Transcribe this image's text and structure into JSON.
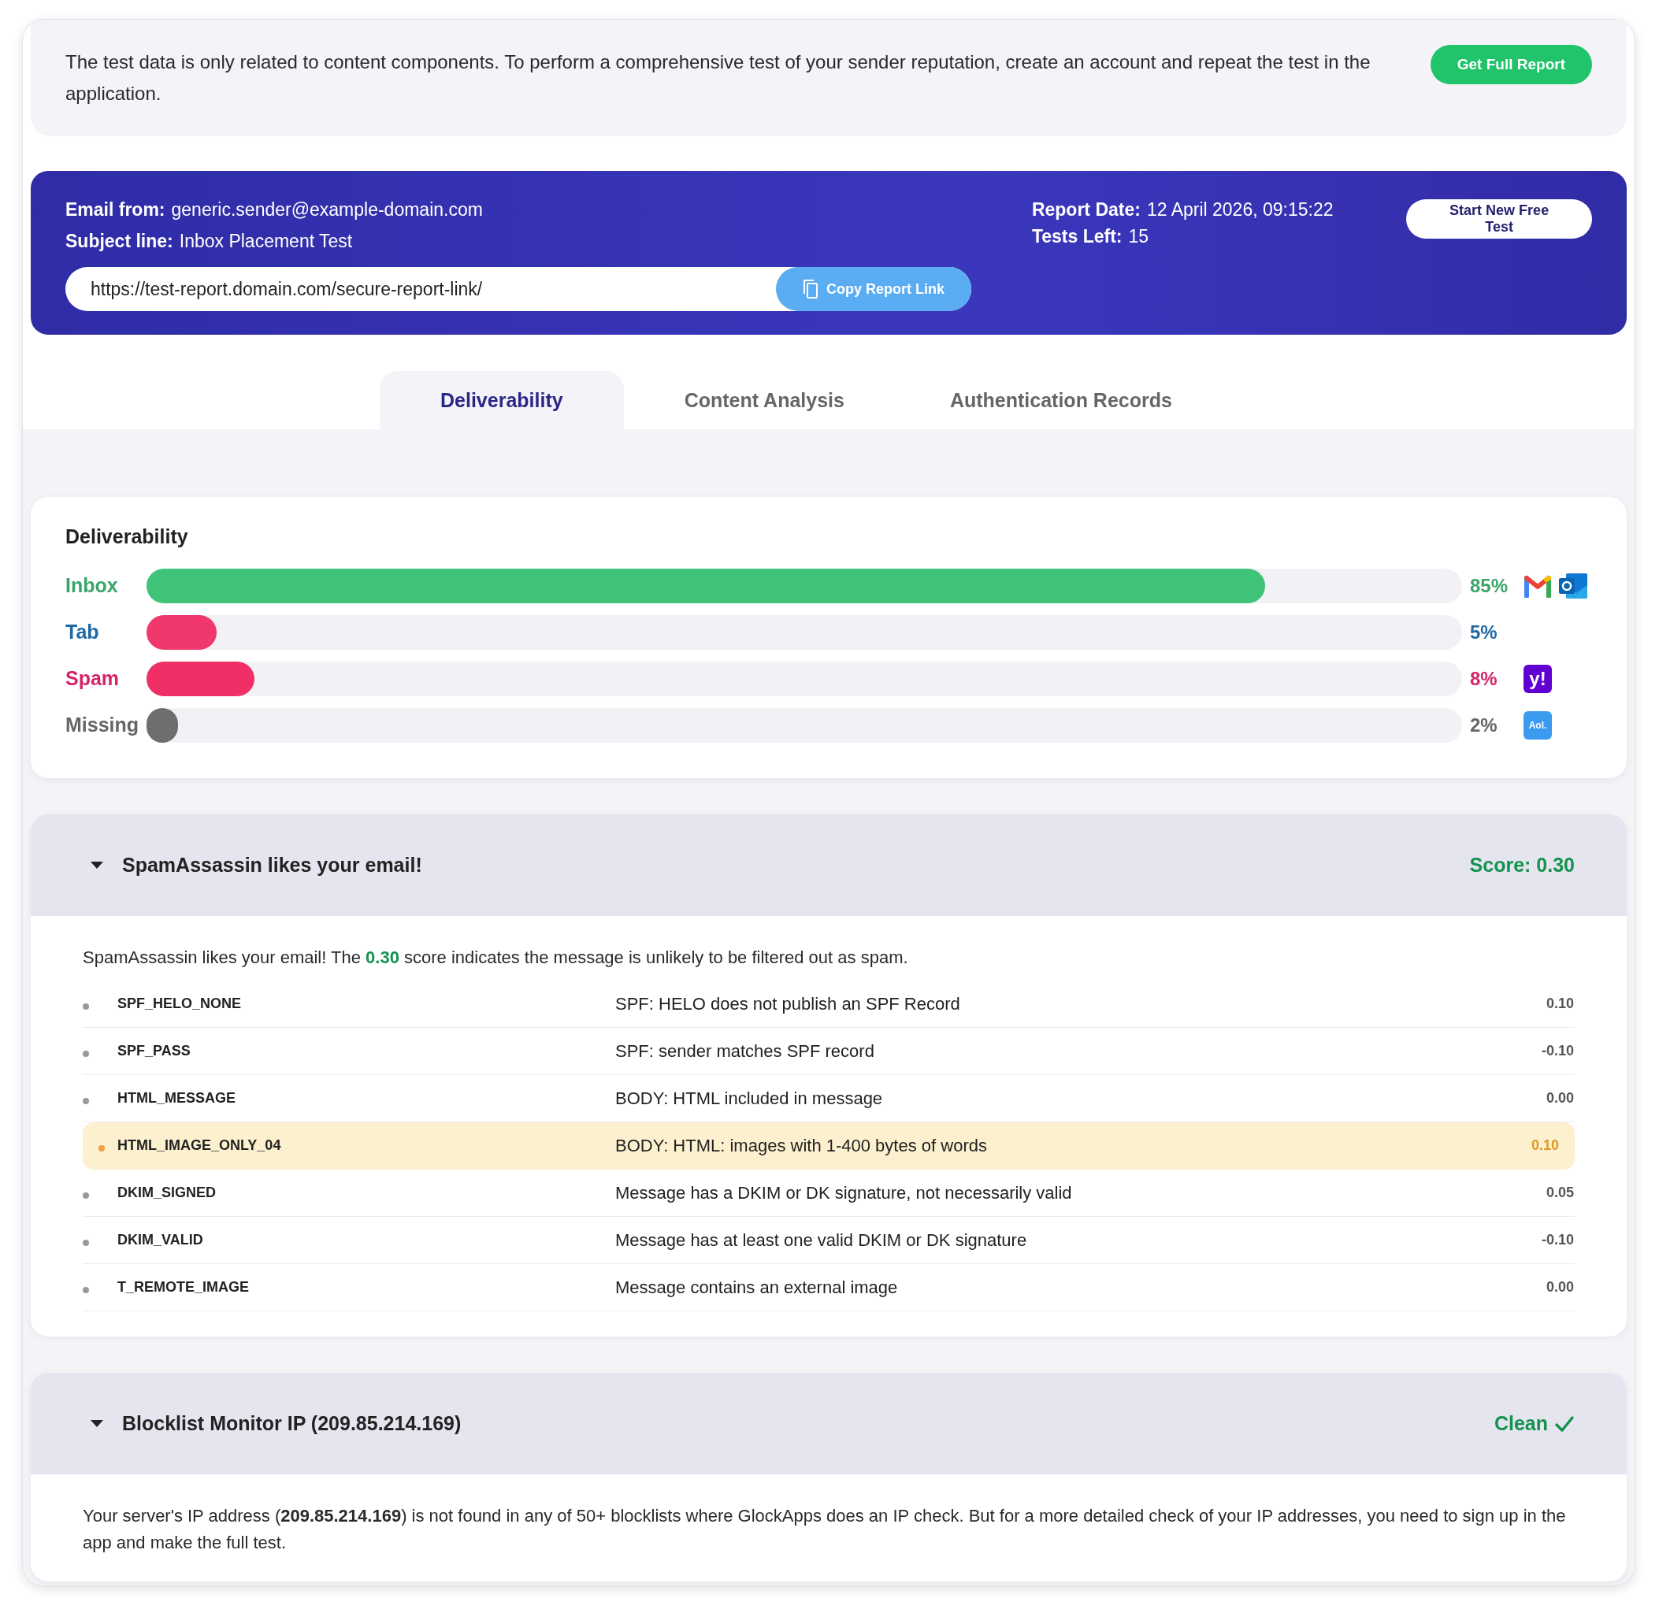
{
  "notice": {
    "text": "The test data is only related to content components. To perform a comprehensive test of your sender reputation, create an account and repeat the test in the application.",
    "button": "Get Full Report"
  },
  "report": {
    "fields": [
      {
        "label": "Email from:",
        "value": "generic.sender@example-domain.com"
      },
      {
        "label": "Subject line:",
        "value": "Inbox Placement Test"
      }
    ],
    "meta": [
      {
        "label": "Report Date:",
        "value": "12 April 2026, 09:15:22"
      },
      {
        "label": "Tests Left:",
        "value": "15"
      }
    ],
    "link": "https://test-report.domain.com/secure-report-link/",
    "copy_button": "Copy Report Link",
    "new_test_button": "Start New Free Test"
  },
  "tabs": [
    {
      "label": "Deliverability",
      "selected": true
    },
    {
      "label": "Content Analysis",
      "selected": false
    },
    {
      "label": "Authentication Records",
      "selected": false
    }
  ],
  "deliverability": {
    "title": "Deliverability",
    "rows": [
      {
        "label": "Inbox",
        "level": 0.85,
        "reading": "85%",
        "color": "#3fc378",
        "icons": [
          {
            "kind": "gmail"
          },
          {
            "kind": "outlook"
          }
        ]
      },
      {
        "label": "Tab",
        "level": 0.053,
        "reading": "5%",
        "color": "#f0386c",
        "icons": []
      },
      {
        "label": "Spam",
        "level": 0.082,
        "reading": "8%",
        "color": "#ef2f66",
        "icons": [
          {
            "kind": "yahoo",
            "text": "y!"
          }
        ]
      },
      {
        "label": "Missing",
        "level": 0.024,
        "reading": "2%",
        "color": "#6e6e6e",
        "icons": [
          {
            "kind": "aol",
            "text": "Aol."
          }
        ]
      }
    ]
  },
  "sections": [
    {
      "kind": "spam",
      "title": "SpamAssassin likes your email!",
      "status": "Score: 0.30",
      "expanded": true,
      "text": "SpamAssassin likes your email! The **0.30** score indicates the message is unlikely to be filtered out as spam.",
      "rules": [
        {
          "rule": "SPF_HELO_NONE",
          "description": "SPF: HELO does not publish an SPF Record",
          "score": "0.10",
          "highlighted": false
        },
        {
          "rule": "SPF_PASS",
          "description": "SPF: sender matches SPF record",
          "score": "-0.10",
          "highlighted": false
        },
        {
          "rule": "HTML_MESSAGE",
          "description": "BODY: HTML included in message",
          "score": "0.00",
          "highlighted": false
        },
        {
          "rule": "HTML_IMAGE_ONLY_04",
          "description": "BODY: HTML: images with 1-400 bytes of words",
          "score": "0.10",
          "highlighted": true
        },
        {
          "rule": "DKIM_SIGNED",
          "description": "Message has a DKIM or DK signature, not necessarily valid",
          "score": "0.05",
          "highlighted": false
        },
        {
          "rule": "DKIM_VALID",
          "description": "Message has at least one valid DKIM or DK signature",
          "score": "-0.10",
          "highlighted": false
        },
        {
          "rule": "T_REMOTE_IMAGE",
          "description": "Message contains an external image",
          "score": "0.00",
          "highlighted": false
        }
      ]
    },
    {
      "kind": "blocklist",
      "title": "Blocklist Monitor IP (209.85.214.169)",
      "status": "Clean",
      "expanded": true,
      "text": "Your server's IP address (**209.85.214.169**) is not found in any of 50+ blocklists where GlockApps does an IP check. But for a more detailed check of your IP addresses, you need to sign up in the app and make the full test."
    }
  ]
}
